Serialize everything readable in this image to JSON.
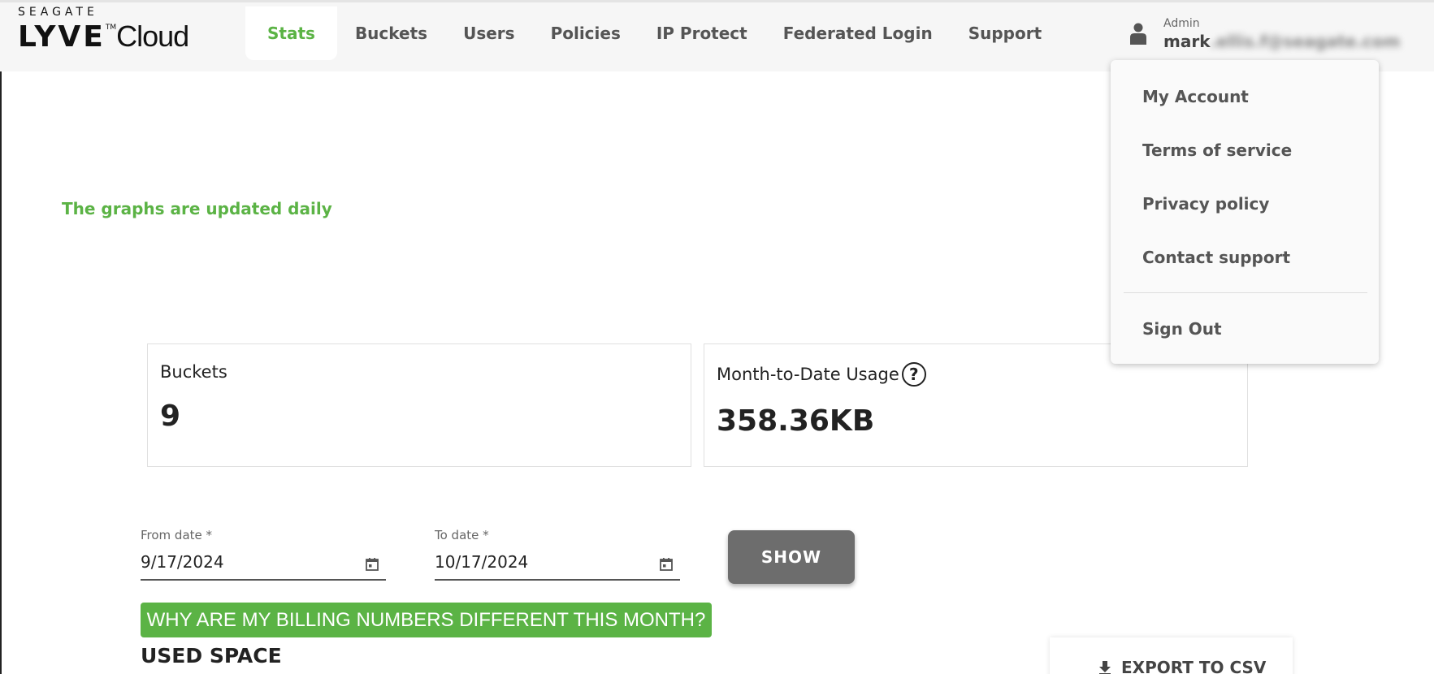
{
  "logo": {
    "top": "SEAGATE",
    "main": "LYVE",
    "tm": "TM",
    "product": "Cloud"
  },
  "nav": {
    "items": [
      {
        "label": "Stats",
        "active": true
      },
      {
        "label": "Buckets"
      },
      {
        "label": "Users"
      },
      {
        "label": "Policies"
      },
      {
        "label": "IP Protect"
      },
      {
        "label": "Federated Login"
      },
      {
        "label": "Support"
      }
    ]
  },
  "user": {
    "role": "Admin",
    "name": "mark",
    "email_blurred": ".ellis.f@seagate.com",
    "icon": "person-icon"
  },
  "user_menu": {
    "items": [
      "My Account",
      "Terms of service",
      "Privacy policy",
      "Contact support"
    ],
    "sign_out": "Sign Out"
  },
  "notice": "The graphs are updated daily",
  "cards": {
    "buckets": {
      "title": "Buckets",
      "value": "9"
    },
    "usage": {
      "title": "Month-to-Date Usage",
      "value": "358.36KB",
      "help_icon": "?"
    }
  },
  "filters": {
    "from": {
      "label": "From date *",
      "value": "9/17/2024"
    },
    "to": {
      "label": "To date *",
      "value": "10/17/2024"
    },
    "show_label": "SHOW"
  },
  "billing_link": "WHY ARE MY BILLING NUMBERS DIFFERENT THIS MONTH?",
  "section_title": "USED SPACE",
  "export_label": "EXPORT TO CSV",
  "colors": {
    "accent": "#5bb345",
    "topbar_bg": "#f6f6f6",
    "show_button": "#6d6d6d"
  }
}
